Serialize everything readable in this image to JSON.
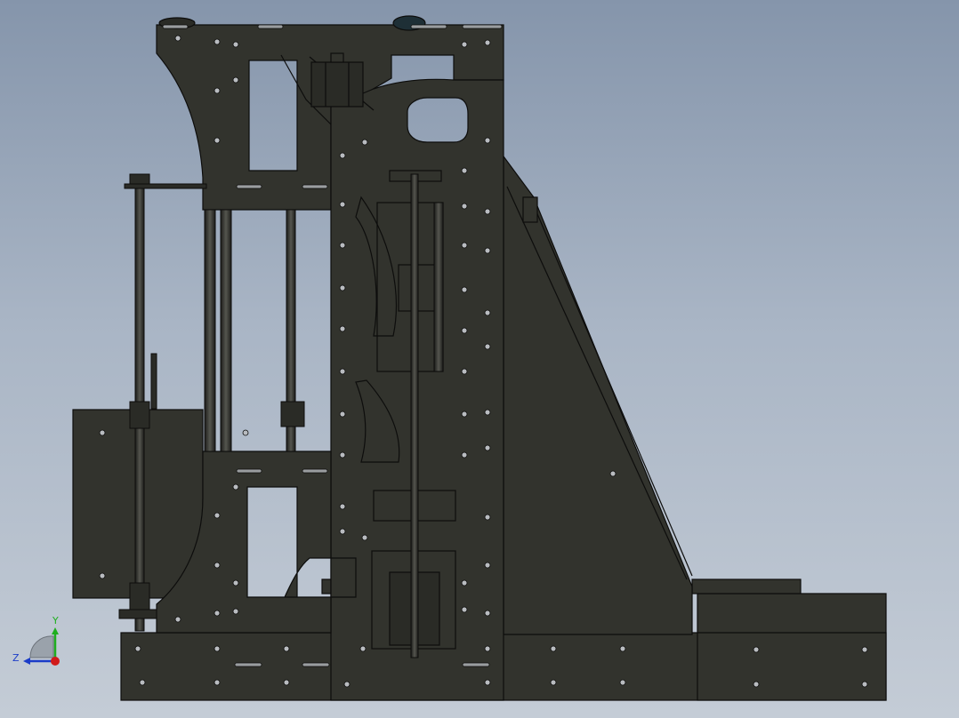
{
  "viewport": {
    "background_top": "#8595ab",
    "background_bottom": "#c4ccd6"
  },
  "model": {
    "body_color": "#32332d",
    "edge_color": "#0d0d0c",
    "highlight_color": "#4a4b44"
  },
  "triad": {
    "y_label": "Y",
    "z_label": "Z",
    "y_color": "#1fae1f",
    "z_color": "#1b3cc8",
    "x_color": "#d11a1a"
  }
}
